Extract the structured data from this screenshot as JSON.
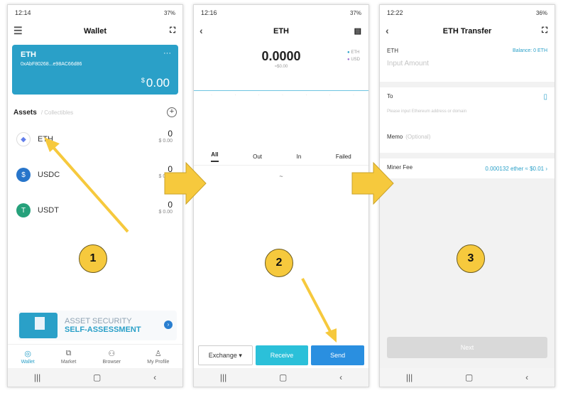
{
  "phone1": {
    "status_time": "12:14",
    "status_right": "37%",
    "title": "Wallet",
    "card": {
      "name": "ETH",
      "address": "0xAbF80268...e98AC66d86",
      "currency": "$",
      "balance": "0.00"
    },
    "assets_label": "Assets",
    "collectibles_label": "Collectibles",
    "assets": [
      {
        "symbol": "ETH",
        "amount": "0",
        "usd": "$ 0.00"
      },
      {
        "symbol": "USDC",
        "amount": "0",
        "usd": "$ 0.00"
      },
      {
        "symbol": "USDT",
        "amount": "0",
        "usd": "$ 0.00"
      }
    ],
    "banner": {
      "line1": "ASSET SECURITY",
      "line2": "SELF-ASSESSMENT"
    },
    "tabs": [
      "Wallet",
      "Market",
      "Browser",
      "My Profile"
    ],
    "step": "1"
  },
  "phone2": {
    "status_time": "12:16",
    "status_right": "37%",
    "title": "ETH",
    "value": "0.0000",
    "value_usd": "≈$0.00",
    "legend": [
      "ETH",
      "USD"
    ],
    "filters": [
      "All",
      "Out",
      "In",
      "Failed"
    ],
    "empty": "~",
    "buttons": {
      "exchange": "Exchange",
      "receive": "Receive",
      "send": "Send"
    },
    "step": "2"
  },
  "phone3": {
    "status_time": "12:22",
    "status_right": "36%",
    "title": "ETH Transfer",
    "eth_label": "ETH",
    "balance": "Balance: 0 ETH",
    "amount_placeholder": "Input Amount",
    "to_label": "To",
    "to_placeholder": "Please input Ethereum address or domain",
    "memo_label": "Memo",
    "memo_optional": "(Optional)",
    "fee_label": "Miner Fee",
    "fee_value": "0.000132 ether ≈ $0.01",
    "next": "Next",
    "step": "3"
  },
  "colors": {
    "accent": "#2aa0c8",
    "arrow": "#f6c93d",
    "send": "#2a8fe0",
    "receive": "#2bc0d9"
  }
}
